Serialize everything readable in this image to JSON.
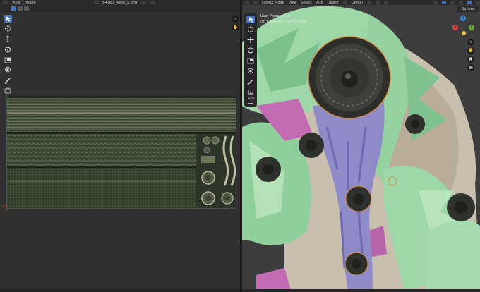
{
  "left_header": {
    "view_label": "View",
    "image_label": "Image",
    "image_name": "o4760_Metal_a.png"
  },
  "right_header": {
    "mode_label": "Object Mode",
    "view_label": "View",
    "select_label": "Select",
    "add_label": "Add",
    "object_label": "Object",
    "orientation_label": "Global",
    "options_label": "Options"
  },
  "viewport_info": {
    "perspective": "User Perspective",
    "collection": "(0) Collection | o4760.040"
  },
  "gizmo_axes": {
    "x": "X",
    "y": "Y",
    "z": "Z"
  },
  "colors": {
    "accent": "#4772b3",
    "axis_x": "#e2404f",
    "axis_y": "#6ba935",
    "axis_z": "#3f8fe0",
    "cursor": "#d04a3a"
  },
  "icons": {
    "uv_tools": [
      "select-box-icon",
      "cursor-icon",
      "move-icon",
      "rotate-icon",
      "scale-icon",
      "transform-icon",
      "annotate-icon",
      "grab-icon"
    ],
    "viewport_tools": [
      "select-box-icon",
      "cursor-icon",
      "move-icon",
      "rotate-icon",
      "scale-icon",
      "transform-icon",
      "annotate-icon",
      "measure-icon",
      "add-cube-icon"
    ]
  }
}
